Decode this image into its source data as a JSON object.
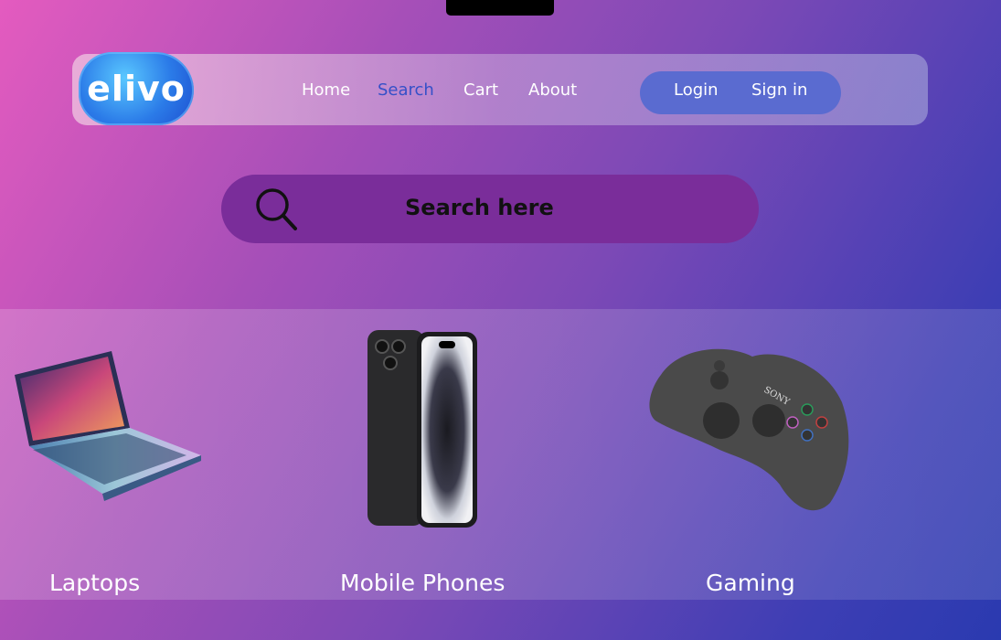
{
  "brand": {
    "logo_text": "elivo"
  },
  "nav": {
    "links": [
      "Home",
      "Search",
      "Cart",
      "About"
    ],
    "active": "Search"
  },
  "auth": {
    "login": "Login",
    "signin": "Sign in"
  },
  "search": {
    "placeholder": "Search here"
  },
  "categories": [
    {
      "label": "Laptops",
      "icon": "laptop-icon"
    },
    {
      "label": "Mobile Phones",
      "icon": "smartphone-icon"
    },
    {
      "label": "Gaming",
      "icon": "gamepad-icon"
    }
  ],
  "colors": {
    "active_link": "#3550c8",
    "auth_pill": "#5a6bd0",
    "search_bar": "#7a2d9a"
  }
}
